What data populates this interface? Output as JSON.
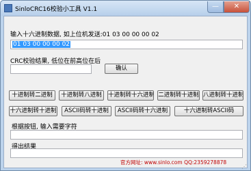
{
  "window": {
    "title": "SinloCRC16校验小工具 V1.1",
    "minimize_glyph": "—",
    "close_glyph": "✕"
  },
  "input_section": {
    "label": "输入十六进制数据, 如上位机发送:01 03 00 00 00 02",
    "value": "01 03 00 00 00 02"
  },
  "crc_section": {
    "label": "CRC校验结果, 低位在前高位在后",
    "value": "",
    "confirm_button": "确认"
  },
  "convert_buttons_row1": [
    "十进制转二进制",
    "十进制转八进制",
    "十进制转十六进制",
    "二进制转十进制",
    "八进制转十进制"
  ],
  "convert_buttons_row2": [
    "十六进制转十进制",
    "ASCII码转十进制",
    "ASCII码转十六进制",
    "十六进制转ASCII码"
  ],
  "convert_input": {
    "label": "根据按钮, 输入需要字符",
    "value": ""
  },
  "convert_result": {
    "label": "得出结果",
    "value": ""
  },
  "footer": "官方网址: www.sinlo.com  QQ:2359278878"
}
